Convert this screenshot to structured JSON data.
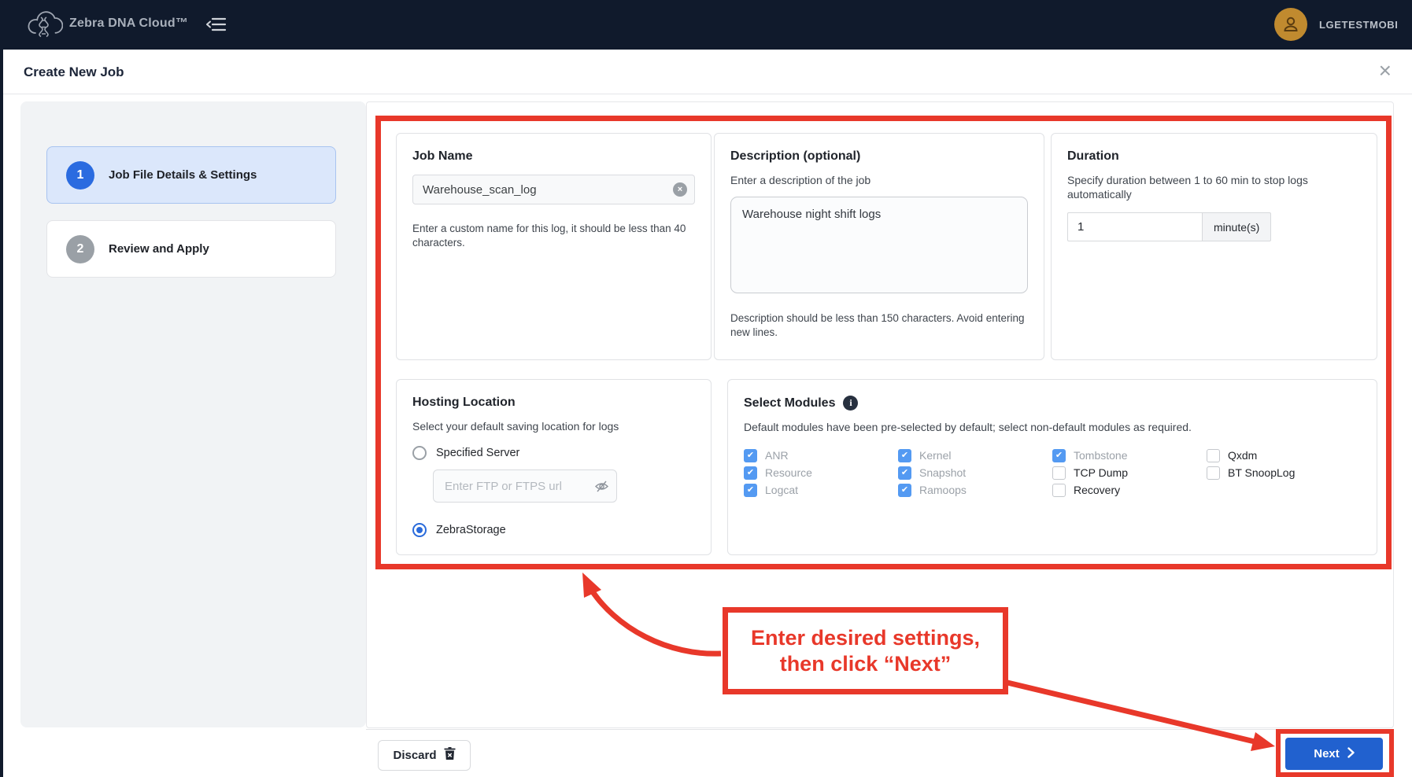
{
  "header": {
    "app_title": "Zebra DNA Cloud™",
    "username": "LGETESTMOBI"
  },
  "page": {
    "title": "Create New Job"
  },
  "steps": [
    {
      "number": "1",
      "label": "Job File Details & Settings",
      "active": true
    },
    {
      "number": "2",
      "label": "Review and Apply",
      "active": false
    }
  ],
  "job_name": {
    "title": "Job Name",
    "value": "Warehouse_scan_log",
    "helper": "Enter a custom name for this log, it should be less than 40 characters."
  },
  "description": {
    "title": "Description (optional)",
    "subtitle": "Enter a description of the job",
    "value": "Warehouse night shift logs",
    "helper": "Description should be less than 150 characters. Avoid entering new lines."
  },
  "duration": {
    "title": "Duration",
    "subtitle": "Specify duration between 1 to 60 min to stop logs automatically",
    "value": "1",
    "unit": "minute(s)"
  },
  "hosting": {
    "title": "Hosting Location",
    "subtitle": "Select your default saving location for logs",
    "options": [
      {
        "label": "Specified Server",
        "selected": false
      },
      {
        "label": "ZebraStorage",
        "selected": true
      }
    ],
    "url_placeholder": "Enter FTP or FTPS url"
  },
  "modules": {
    "title": "Select Modules",
    "subtitle": "Default modules have been pre-selected by default; select non-default modules as required.",
    "columns": [
      [
        {
          "label": "ANR",
          "checked": true
        },
        {
          "label": "Resource",
          "checked": true
        },
        {
          "label": "Logcat",
          "checked": true
        }
      ],
      [
        {
          "label": "Kernel",
          "checked": true
        },
        {
          "label": "Snapshot",
          "checked": true
        },
        {
          "label": "Ramoops",
          "checked": true
        }
      ],
      [
        {
          "label": "Tombstone",
          "checked": true
        },
        {
          "label": "TCP Dump",
          "checked": false
        },
        {
          "label": "Recovery",
          "checked": false
        }
      ],
      [
        {
          "label": "Qxdm",
          "checked": false
        },
        {
          "label": "BT SnoopLog",
          "checked": false
        }
      ]
    ]
  },
  "footer": {
    "discard_label": "Discard",
    "next_label": "Next"
  },
  "annotation": {
    "line1": "Enter desired settings,",
    "line2": "then click “Next”",
    "color": "#e8382a"
  },
  "icons": {
    "close": "×",
    "clear": "×",
    "check": "✔",
    "info": "i"
  },
  "colors": {
    "header_bg": "#101a2c",
    "accent_blue": "#2a6bdb",
    "next_button_blue": "#2161cf",
    "annotation_red": "#e8382a",
    "avatar_gold": "#c08a2f",
    "active_step_bg": "#dbe7fb"
  }
}
